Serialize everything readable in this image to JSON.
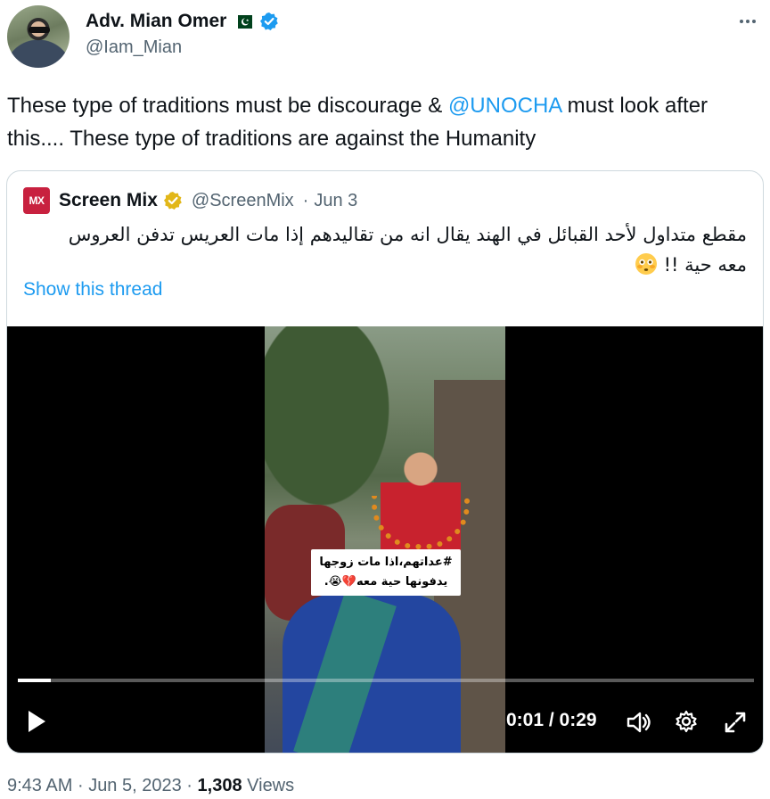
{
  "author": {
    "display_name": "Adv. Mian Omer",
    "handle": "@Iam_Mian",
    "flag": "pakistan-flag-icon",
    "badge": "verified-blue-icon"
  },
  "tweet": {
    "text_before": "These type of traditions must be discourage & ",
    "mention": "@UNOCHA",
    "text_after": " must look after this.... These type of traditions are against the Humanity"
  },
  "quote": {
    "logo_text": "MX",
    "display_name": "Screen Mix",
    "badge": "verified-gold-icon",
    "handle": "@ScreenMix",
    "separator": "·",
    "date": "Jun 3",
    "text": "مقطع متداول لأحد القبائل في الهند يقال انه من تقاليدهم إذا مات العريس تدفن العروس معه حية !!",
    "show_thread": "Show this thread"
  },
  "video": {
    "caption_line1": "#عداتهم،اذا مات زوجها",
    "caption_line2": "يدفونها حية معه💔😭.",
    "current_time": "0:01",
    "duration": "0:29",
    "time_separator": " / ",
    "progress": 0.045
  },
  "meta": {
    "time": "9:43 AM",
    "separator": "·",
    "date": "Jun 5, 2023",
    "views_count": "1,308",
    "views_label": "Views"
  },
  "colors": {
    "accent": "#1d9bf0",
    "text": "#0f1419",
    "secondary": "#536471",
    "border": "#cfd9de"
  }
}
